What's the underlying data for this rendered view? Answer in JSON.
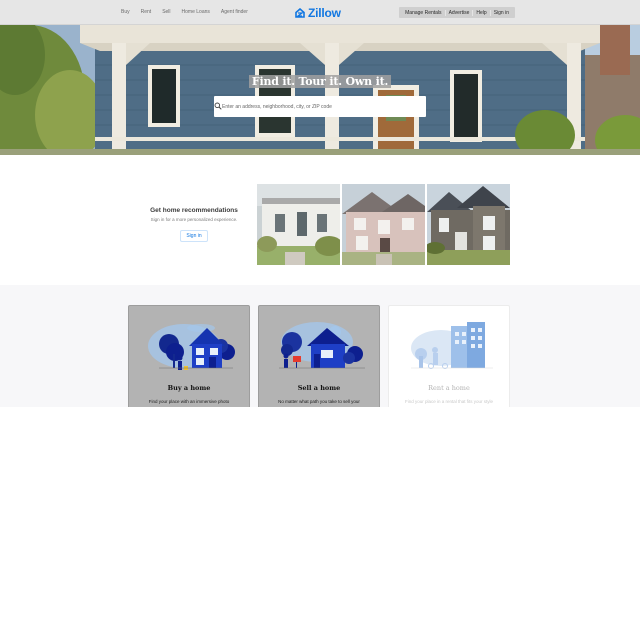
{
  "nav": {
    "left_links": [
      "Buy",
      "Rent",
      "Sell",
      "Home Loans",
      "Agent finder"
    ],
    "logo_text": "Zillow",
    "right_links": [
      "Manage Rentals",
      "Advertise",
      "Help",
      "Sign in"
    ]
  },
  "hero": {
    "headline": "Find it. Tour it. Own it.",
    "search_placeholder": "Enter an address, neighborhood, city, or ZIP code"
  },
  "recommendations": {
    "title": "Get home recommendations",
    "subtitle": "Sign in for a more personalized experience.",
    "button": "Sign in"
  },
  "cards": [
    {
      "title": "Buy a home",
      "description": "Find your place with an immersive photo"
    },
    {
      "title": "Sell a home",
      "description": "No matter what path you take to sell your"
    },
    {
      "title": "Rent a home",
      "description": "Find your place in a rental that fits your style"
    }
  ],
  "colors": {
    "brand": "#1277e1",
    "navy": "#0d1f8f",
    "nav_bg": "#e6e6e6"
  }
}
